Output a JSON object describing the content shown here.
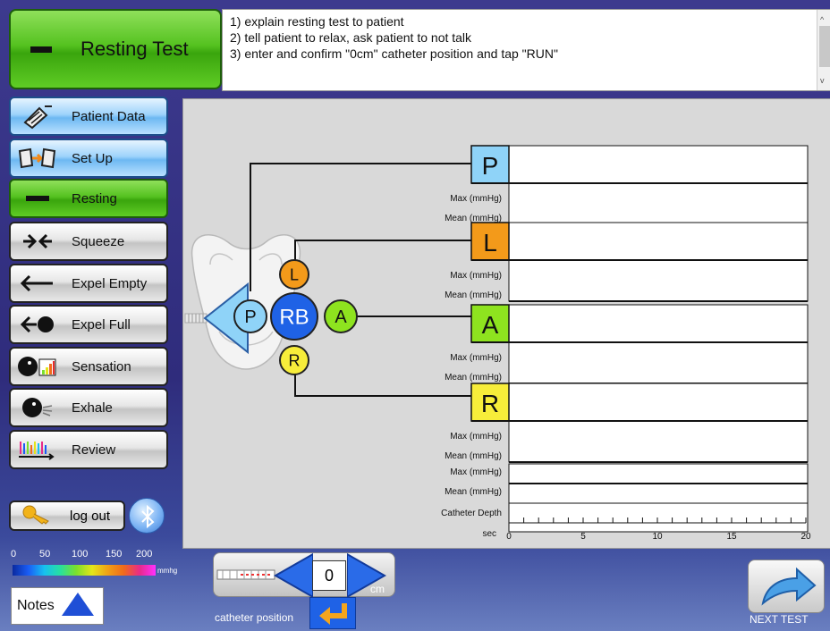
{
  "header": {
    "test_label": "Resting Test"
  },
  "instructions": {
    "lines": [
      "1) explain resting test to patient",
      "2) tell patient to relax, ask patient to not talk",
      "3) enter and confirm \"0cm\" catheter position and tap \"RUN\""
    ],
    "scroll_up": "^",
    "scroll_down": "v"
  },
  "sidebar": {
    "items": [
      {
        "label": "Patient Data",
        "icon": "patient-data-icon"
      },
      {
        "label": "Set Up",
        "icon": "setup-icon"
      },
      {
        "label": "Resting",
        "icon": "dash-icon"
      },
      {
        "label": "Squeeze",
        "icon": "squeeze-icon"
      },
      {
        "label": "Expel Empty",
        "icon": "expel-empty-icon"
      },
      {
        "label": "Expel Full",
        "icon": "expel-full-icon"
      },
      {
        "label": "Sensation",
        "icon": "sensation-icon"
      },
      {
        "label": "Exhale",
        "icon": "exhale-icon"
      },
      {
        "label": "Review",
        "icon": "review-icon"
      }
    ],
    "logout_label": "log out"
  },
  "diagram": {
    "labels": {
      "P": "P",
      "RB": "RB",
      "L": "L",
      "A": "A",
      "R": "R"
    },
    "colors": {
      "P": "#8fd3f8",
      "L": "#f39a1a",
      "A": "#8ee31f",
      "R": "#f7ed3a",
      "RB": "#1f62e6"
    }
  },
  "channels": [
    {
      "label": "P",
      "color": "#8fd3f8"
    },
    {
      "label": "L",
      "color": "#f39a1a"
    },
    {
      "label": "A",
      "color": "#8ee31f"
    },
    {
      "label": "R",
      "color": "#f7ed3a"
    }
  ],
  "row_labels": {
    "max": "Max (mmHg)",
    "mean": "Mean (mmHg)",
    "catheter_depth": "Catheter Depth",
    "sec": "sec"
  },
  "axis": {
    "ticks": [
      "0",
      "5",
      "10",
      "15",
      "20"
    ],
    "range": [
      0,
      20
    ]
  },
  "scale": {
    "ticks": [
      "0",
      "50",
      "100",
      "150",
      "200"
    ],
    "unit": "mmhg"
  },
  "notes_label": "Notes",
  "catheter": {
    "value": "0",
    "unit": "cm",
    "label": "catheter position"
  },
  "next_label": "NEXT TEST"
}
